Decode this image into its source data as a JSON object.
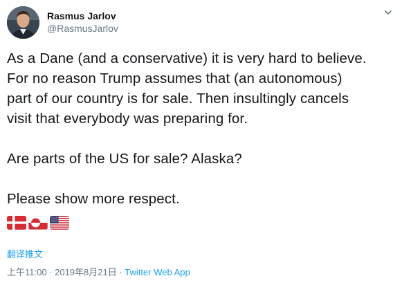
{
  "author": {
    "display_name": "Rasmus Jarlov",
    "handle": "@RasmusJarlov",
    "avatar_icon": "avatar-photo"
  },
  "tweet": {
    "text": "As a Dane (and a conservative) it is very hard to believe.\nFor no reason Trump assumes that (an autonomous)\npart of our country is for sale. Then insultingly cancels\nvisit that everybody was preparing for.\n\nAre parts of the US for sale? Alaska?\n\nPlease show more respect.",
    "flags": [
      "denmark-flag-emoji",
      "greenland-flag-emoji",
      "united-states-flag-emoji"
    ]
  },
  "translate_label": "翻译推文",
  "timestamp": "上午11:00 · 2019年8月21日",
  "separator": " · ",
  "source": "Twitter Web App",
  "colors": {
    "link": "#1da1f2",
    "secondary": "#657786",
    "text": "#14171a"
  }
}
